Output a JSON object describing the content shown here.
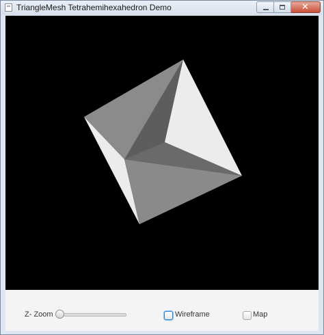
{
  "window": {
    "title": "TriangleMesh Tetrahemihexahedron Demo",
    "icon": "app-window-icon",
    "controls": [
      "minimize-icon",
      "maximize-icon",
      "close-icon"
    ]
  },
  "controls": {
    "zoom_label": "Z- Zoom",
    "zoom_value": 0.0,
    "wireframe_label": "Wireframe",
    "wireframe_checked": false,
    "map_label": "Map",
    "map_checked": false
  },
  "colors": {
    "background": "#000000",
    "face_light": "#ececec",
    "face_mid": "#8a8a8a",
    "face_dark": "#5c5c5c",
    "accent_focus": "#2f7fd3"
  }
}
